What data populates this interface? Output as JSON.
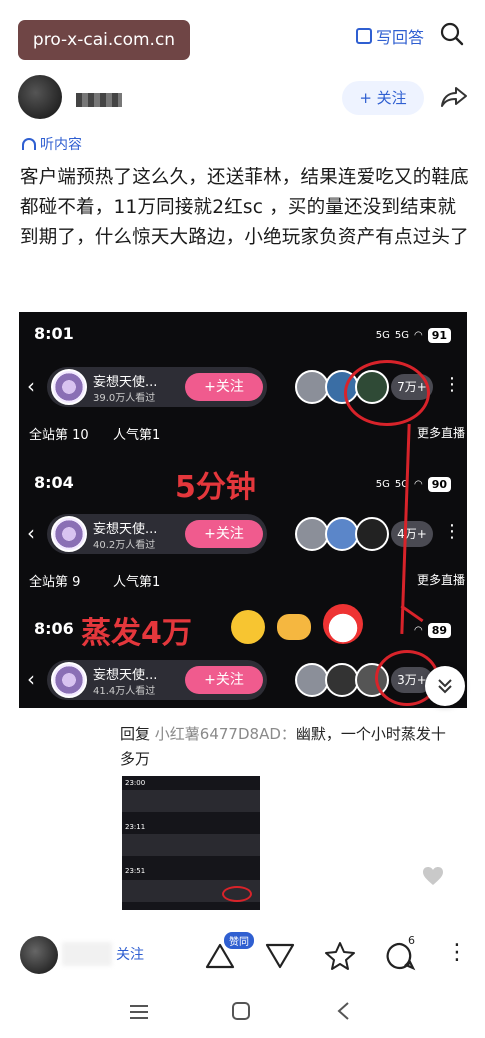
{
  "header": {
    "watermark": "pro-x-cai.com.cn",
    "write_answer": "写回答"
  },
  "author": {
    "follow_label": "+ 关注"
  },
  "listen_label": "听内容",
  "post_text": "客户端预热了这么久，还送菲林，结果连爱吃又的鞋底都碰不着，11万同接就2红sc ，买的量还没到结束就到期了，什么惊天大路边，小绝玩家负资产有点过头了",
  "screenshot": {
    "panels": [
      {
        "time": "8:01",
        "battery": "91",
        "streamer": "妄想天使...",
        "viewers": "39.0万人看过",
        "follow": "+关注",
        "count": "7万+",
        "rank": "全站第 10",
        "popularity": "人气第1",
        "more": "更多直播"
      },
      {
        "time": "8:04",
        "battery": "90",
        "streamer": "妄想天使...",
        "viewers": "40.2万人看过",
        "follow": "+关注",
        "count": "4万+",
        "rank": "全站第 9",
        "popularity": "人气第1",
        "more": "更多直播"
      },
      {
        "time": "8:06",
        "battery": "89",
        "streamer": "妄想天使...",
        "viewers": "41.4万人看过",
        "follow": "+关注",
        "count": "3万+"
      }
    ],
    "annotation_minutes": "5分钟",
    "annotation_evaporate": "蒸发4万",
    "signal": "5G"
  },
  "reply": {
    "label": "回复",
    "nickname": "小红薯6477D8AD：",
    "text": "幽默，一个小时蒸发十多万"
  },
  "thumbnail_times": [
    "23:00",
    "23:11",
    "23:51"
  ],
  "bottom": {
    "follow_label": "关注",
    "like_badge": "赞同",
    "comment_count": "6"
  },
  "colors": {
    "accent": "#2f5fd1",
    "annotation_red": "#d8232a",
    "follow_pink": "#f05b8e"
  }
}
